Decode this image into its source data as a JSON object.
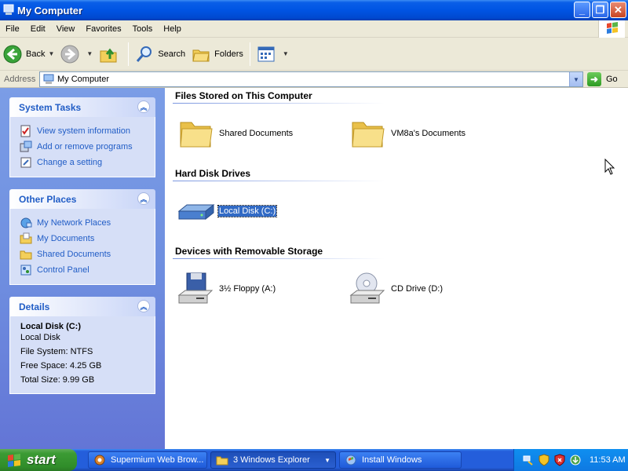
{
  "window": {
    "title": "My Computer"
  },
  "menu": [
    "File",
    "Edit",
    "View",
    "Favorites",
    "Tools",
    "Help"
  ],
  "toolbar": {
    "back_label": "Back",
    "search_label": "Search",
    "folders_label": "Folders"
  },
  "address": {
    "label": "Address",
    "value": "My Computer",
    "go_label": "Go"
  },
  "sidebar": {
    "system_tasks": {
      "title": "System Tasks",
      "items": [
        "View system information",
        "Add or remove programs",
        "Change a setting"
      ]
    },
    "other_places": {
      "title": "Other Places",
      "items": [
        "My Network Places",
        "My Documents",
        "Shared Documents",
        "Control Panel"
      ]
    },
    "details": {
      "title": "Details",
      "name": "Local Disk (C:)",
      "type": "Local Disk",
      "file_system": "File System: NTFS",
      "free_space": "Free Space: 4.25 GB",
      "total_size": "Total Size: 9.99 GB"
    }
  },
  "main": {
    "sections": {
      "files": {
        "title": "Files Stored on This Computer",
        "items": [
          "Shared Documents",
          "VM8a's Documents"
        ]
      },
      "hdd": {
        "title": "Hard Disk Drives",
        "items": [
          "Local Disk (C:)"
        ]
      },
      "removable": {
        "title": "Devices with Removable Storage",
        "items": [
          "3½ Floppy (A:)",
          "CD Drive (D:)"
        ]
      }
    }
  },
  "taskbar": {
    "start_label": "start",
    "tasks": [
      "Supermium Web Brow...",
      "3 Windows Explorer",
      "Install Windows"
    ],
    "clock": "11:53 AM"
  },
  "colors": {
    "accent": "#0054e3",
    "link": "#215dc6",
    "sidebar_bg": "#6f8fe0",
    "start_green": "#3c9b34"
  }
}
